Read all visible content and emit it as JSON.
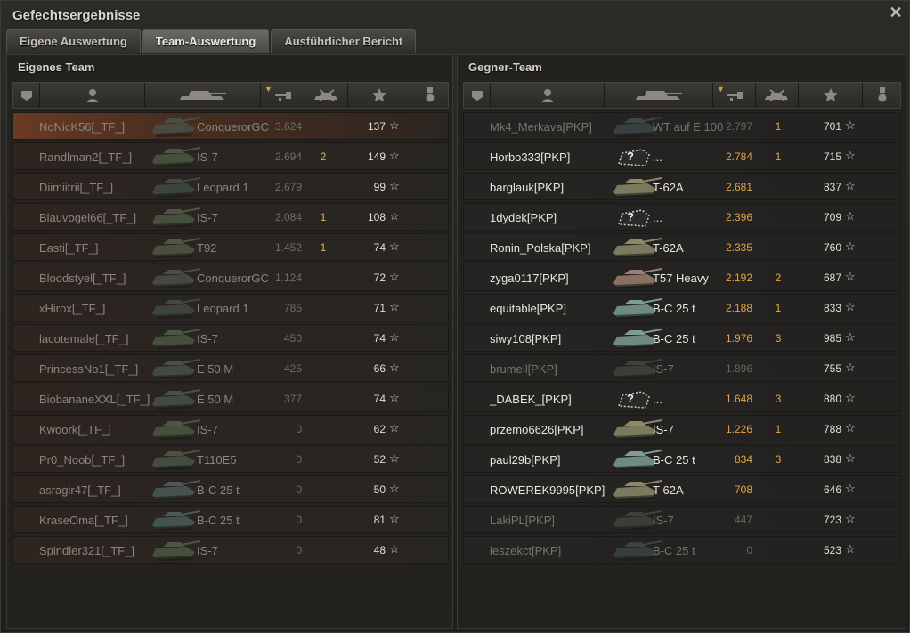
{
  "window": {
    "title": "Gefechtsergebnisse"
  },
  "tabs": [
    {
      "label": "Eigene Auswertung",
      "active": false
    },
    {
      "label": "Team-Auswertung",
      "active": true
    },
    {
      "label": "Ausführlicher Bericht",
      "active": false
    }
  ],
  "own_team": {
    "title": "Eigenes Team",
    "rows": [
      {
        "name": "NoNicK56[_TF_]",
        "tank": "ConquerorGC",
        "damage": "3.624",
        "kills": "",
        "xp": "137",
        "tank_color": "#4a4f44",
        "player": true
      },
      {
        "name": "Randlman2[_TF_]",
        "tank": "IS-7",
        "damage": "2.694",
        "kills": "2",
        "xp": "149",
        "tank_color": "#4b5740"
      },
      {
        "name": "Diimiitrii[_TF_]",
        "tank": "Leopard 1",
        "damage": "2.679",
        "kills": "",
        "xp": "99",
        "tank_color": "#3f4a3f"
      },
      {
        "name": "Blauvogel66[_TF_]",
        "tank": "IS-7",
        "damage": "2.084",
        "kills": "1",
        "xp": "108",
        "tank_color": "#4b5740"
      },
      {
        "name": "Easti[_TF_]",
        "tank": "T92",
        "damage": "1.452",
        "kills": "1",
        "xp": "74",
        "tank_color": "#4f5642"
      },
      {
        "name": "Bloodstyel[_TF_]",
        "tank": "ConquerorGC",
        "damage": "1.124",
        "kills": "",
        "xp": "72",
        "tank_color": "#4a4f44"
      },
      {
        "name": "xHirox[_TF_]",
        "tank": "Leopard 1",
        "damage": "785",
        "kills": "",
        "xp": "71",
        "tank_color": "#3f4a3f"
      },
      {
        "name": "lacotemale[_TF_]",
        "tank": "IS-7",
        "damage": "450",
        "kills": "",
        "xp": "74",
        "tank_color": "#4b5740"
      },
      {
        "name": "PrincessNo1[_TF_]",
        "tank": "E 50 M",
        "damage": "425",
        "kills": "",
        "xp": "66",
        "tank_color": "#48504a"
      },
      {
        "name": "BiobananeXXL[_TF_]",
        "tank": "E 50 M",
        "damage": "377",
        "kills": "",
        "xp": "74",
        "tank_color": "#48504a"
      },
      {
        "name": "Kwoork[_TF_]",
        "tank": "IS-7",
        "damage": "0",
        "kills": "",
        "xp": "62",
        "tank_color": "#4b5740"
      },
      {
        "name": "Pr0_Noob[_TF_]",
        "tank": "T110E5",
        "damage": "0",
        "kills": "",
        "xp": "52",
        "tank_color": "#4a5244"
      },
      {
        "name": "asragir47[_TF_]",
        "tank": "B-C 25 t",
        "damage": "0",
        "kills": "",
        "xp": "50",
        "tank_color": "#4a5a58"
      },
      {
        "name": "KraseOma[_TF_]",
        "tank": "B-C 25 t",
        "damage": "0",
        "kills": "",
        "xp": "81",
        "tank_color": "#4a5a58"
      },
      {
        "name": "Spindler321[_TF_]",
        "tank": "IS-7",
        "damage": "0",
        "kills": "",
        "xp": "48",
        "tank_color": "#4b5740"
      }
    ]
  },
  "enemy_team": {
    "title": "Gegner-Team",
    "rows": [
      {
        "name": "Mk4_Merkava[PKP]",
        "tank": "WT auf E 100",
        "damage": "2.797",
        "kills": "1",
        "xp": "701",
        "dead": true,
        "tank_color": "#3d4548"
      },
      {
        "name": "Horbo333[PKP]",
        "tank": "...",
        "damage": "2.784",
        "kills": "1",
        "xp": "715",
        "unknown": true
      },
      {
        "name": "barglauk[PKP]",
        "tank": "T-62A",
        "damage": "2.681",
        "kills": "",
        "xp": "837",
        "tank_color": "#8a8a68"
      },
      {
        "name": "1dydek[PKP]",
        "tank": "...",
        "damage": "2.396",
        "kills": "",
        "xp": "709",
        "unknown": true
      },
      {
        "name": "Ronin_Polska[PKP]",
        "tank": "T-62A",
        "damage": "2.335",
        "kills": "",
        "xp": "760",
        "tank_color": "#8a8a68"
      },
      {
        "name": "zyga0117[PKP]",
        "tank": "T57 Heavy",
        "damage": "2.192",
        "kills": "2",
        "xp": "687",
        "tank_color": "#9a7f6e"
      },
      {
        "name": "equitable[PKP]",
        "tank": "B-C 25 t",
        "damage": "2.188",
        "kills": "1",
        "xp": "833",
        "tank_color": "#7d9c96"
      },
      {
        "name": "siwy108[PKP]",
        "tank": "B-C 25 t",
        "damage": "1.976",
        "kills": "3",
        "xp": "985",
        "tank_color": "#7d9c96"
      },
      {
        "name": "brumell[PKP]",
        "tank": "IS-7",
        "damage": "1.896",
        "kills": "",
        "xp": "755",
        "dead": true,
        "tank_color": "#3e423c"
      },
      {
        "name": "_DABEK_[PKP]",
        "tank": "...",
        "damage": "1.648",
        "kills": "3",
        "xp": "880",
        "unknown": true
      },
      {
        "name": "przemo6626[PKP]",
        "tank": "IS-7",
        "damage": "1.226",
        "kills": "1",
        "xp": "788",
        "tank_color": "#8a8a68"
      },
      {
        "name": "paul29b[PKP]",
        "tank": "B-C 25 t",
        "damage": "834",
        "kills": "3",
        "xp": "838",
        "tank_color": "#7d9c96"
      },
      {
        "name": "ROWEREK9995[PKP]",
        "tank": "T-62A",
        "damage": "708",
        "kills": "",
        "xp": "646",
        "tank_color": "#8a8a68"
      },
      {
        "name": "LakiPL[PKP]",
        "tank": "IS-7",
        "damage": "447",
        "kills": "",
        "xp": "723",
        "dead": true,
        "tank_color": "#3e423c"
      },
      {
        "name": "leszekct[PKP]",
        "tank": "B-C 25 t",
        "damage": "0",
        "kills": "",
        "xp": "523",
        "dead": true,
        "tank_color": "#3a4442"
      }
    ]
  },
  "header_icons": [
    "squad-icon",
    "player-icon",
    "tank-icon",
    "damage-icon",
    "kills-icon",
    "xp-star-icon",
    "medal-icon"
  ],
  "xp_suffix": "☆"
}
